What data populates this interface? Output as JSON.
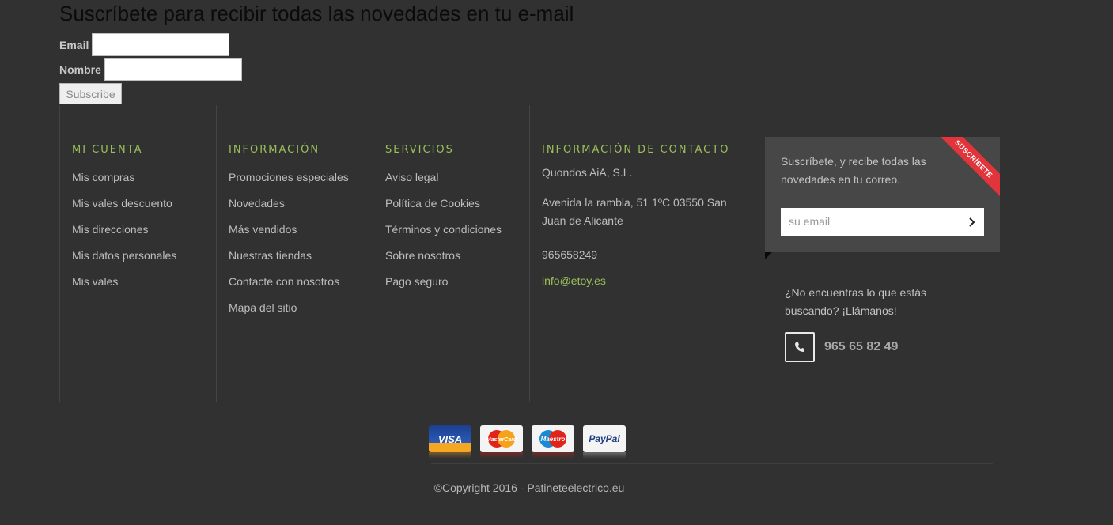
{
  "newsletter": {
    "title": "Suscríbete para recibir todas las novedades en tu e-mail",
    "email_label": "Email",
    "name_label": "Nombre",
    "email_value": "",
    "name_value": "",
    "button_label": "Subscribe"
  },
  "columns": [
    {
      "heading": "MI CUENTA",
      "items": [
        "Mis compras",
        "Mis vales descuento",
        "Mis direcciones",
        "Mis datos personales",
        "Mis vales"
      ]
    },
    {
      "heading": "INFORMACIÓN",
      "items": [
        "Promociones especiales",
        "Novedades",
        "Más vendidos",
        "Nuestras tiendas",
        "Contacte con nosotros",
        "Mapa del sitio"
      ]
    },
    {
      "heading": "SERVICIOS",
      "items": [
        "Aviso legal",
        "Política de Cookies",
        "Términos y condiciones",
        "Sobre nosotros",
        "Pago seguro"
      ]
    }
  ],
  "contact": {
    "heading": "INFORMACIÓN DE CONTACTO",
    "company": "Quondos AiA, S.L.",
    "address": "Avenida la rambla, 51 1ºC 03550 San Juan de Alicante",
    "phone": "965658249",
    "email": "info@etoy.es"
  },
  "subscribe_box": {
    "text": "Suscríbete, y recibe todas las novedades en tu correo.",
    "ribbon": "SUSCRÍBETE",
    "placeholder": "su email"
  },
  "help": {
    "text": "¿No encuentras lo que estás buscando? ¡Llámanos!",
    "phone": "965 65 82 49"
  },
  "payment_cards": [
    {
      "name": "VISA",
      "icon": "visa-icon"
    },
    {
      "name": "MasterCard",
      "icon": "mastercard-icon"
    },
    {
      "name": "Maestro",
      "icon": "maestro-icon"
    },
    {
      "name": "PayPal",
      "icon": "paypal-icon"
    }
  ],
  "footer": {
    "copyright": "©Copyright 2016 - Patineteelectrico.eu"
  },
  "colors": {
    "background": "#313131",
    "accent_green": "#9ac05a",
    "ribbon_red": "#e2343b",
    "box_bg": "#474747"
  }
}
